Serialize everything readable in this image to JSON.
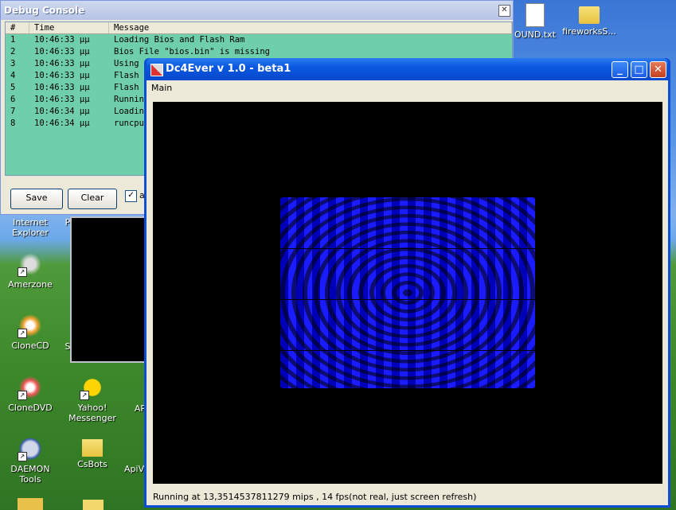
{
  "desktop": {
    "icons": [
      {
        "label": "OUND.txt"
      },
      {
        "label": "fireworksS..."
      },
      {
        "label": "Internet Explorer"
      },
      {
        "label": "Amerzone"
      },
      {
        "label": "CloneCD"
      },
      {
        "label": "CloneDVD"
      },
      {
        "label": "Yahoo! Messenger"
      },
      {
        "label": "DAEMON Tools"
      },
      {
        "label": "CsBots"
      },
      {
        "label": "ApiVi"
      },
      {
        "label": "P"
      },
      {
        "label": "AP"
      },
      {
        "label": "S"
      }
    ]
  },
  "debug_console": {
    "title": "Debug Console",
    "close_glyph": "✕",
    "columns": [
      "#",
      "Time",
      "Message"
    ],
    "rows": [
      {
        "n": "1",
        "time": "10:46:33 μμ",
        "msg": "Loading Bios and Flash Ram"
      },
      {
        "n": "2",
        "time": "10:46:33 μμ",
        "msg": "Bios File \"bios.bin\" is missing"
      },
      {
        "n": "3",
        "time": "10:46:33 μμ",
        "msg": "Using"
      },
      {
        "n": "4",
        "time": "10:46:33 μμ",
        "msg": "Flash"
      },
      {
        "n": "5",
        "time": "10:46:33 μμ",
        "msg": "Flash"
      },
      {
        "n": "6",
        "time": "10:46:33 μμ",
        "msg": "Runnin"
      },
      {
        "n": "7",
        "time": "10:46:34 μμ",
        "msg": "Loadin"
      },
      {
        "n": "8",
        "time": "10:46:34 μμ",
        "msg": "runcpu"
      }
    ],
    "save_label": "Save",
    "clear_label": "Clear",
    "checkbox_checked": "✓",
    "checkbox_label": "a"
  },
  "main_window": {
    "title": "Dc4Ever v 1.0 - beta1",
    "minimize_glyph": "_",
    "maximize_glyph": "□",
    "close_glyph": "✕",
    "menu": [
      "Main"
    ],
    "status": "Running at 13,3514537811279 mips , 14 fps(not real, just screen refresh)"
  }
}
